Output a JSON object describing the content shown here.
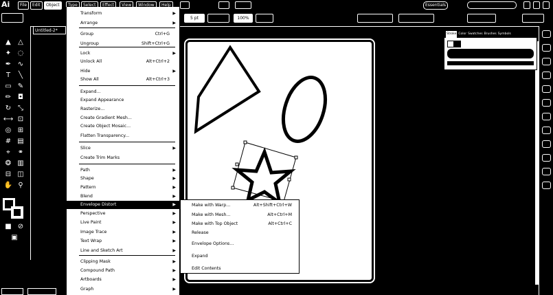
{
  "app": {
    "logo": "Ai"
  },
  "menubar": {
    "items": [
      "File",
      "Edit",
      "Object",
      "Type",
      "Select",
      "Effect",
      "View",
      "Window",
      "Help"
    ],
    "active": "Object",
    "workspace": "Essentials"
  },
  "controlbar": {
    "stroke_value": "5 pt",
    "opacity": "100%"
  },
  "document": {
    "tab_title": "Untitled-2*"
  },
  "object_menu": {
    "items": [
      {
        "label": "Transform",
        "shortcut": "",
        "submenu": true
      },
      {
        "label": "Arrange",
        "shortcut": "",
        "submenu": true
      },
      {
        "label": "Group",
        "shortcut": "Ctrl+G",
        "submenu": false
      },
      {
        "label": "Ungroup",
        "shortcut": "Shift+Ctrl+G",
        "submenu": false
      },
      {
        "label": "Lock",
        "shortcut": "",
        "submenu": true
      },
      {
        "label": "Unlock All",
        "shortcut": "Alt+Ctrl+2",
        "submenu": false
      },
      {
        "label": "Hide",
        "shortcut": "",
        "submenu": true
      },
      {
        "label": "Show All",
        "shortcut": "Alt+Ctrl+3",
        "submenu": false
      },
      {
        "label": "Expand...",
        "shortcut": "",
        "submenu": false
      },
      {
        "label": "Expand Appearance",
        "shortcut": "",
        "submenu": false
      },
      {
        "label": "Rasterize...",
        "shortcut": "",
        "submenu": false
      },
      {
        "label": "Create Gradient Mesh...",
        "shortcut": "",
        "submenu": false
      },
      {
        "label": "Create Object Mosaic...",
        "shortcut": "",
        "submenu": false
      },
      {
        "label": "Flatten Transparency...",
        "shortcut": "",
        "submenu": false
      },
      {
        "label": "Slice",
        "shortcut": "",
        "submenu": true
      },
      {
        "label": "Create Trim Marks",
        "shortcut": "",
        "submenu": false
      },
      {
        "label": "Path",
        "shortcut": "",
        "submenu": true
      },
      {
        "label": "Shape",
        "shortcut": "",
        "submenu": true
      },
      {
        "label": "Pattern",
        "shortcut": "",
        "submenu": true
      },
      {
        "label": "Blend",
        "shortcut": "",
        "submenu": true
      },
      {
        "label": "Envelope Distort",
        "shortcut": "",
        "submenu": true
      },
      {
        "label": "Perspective",
        "shortcut": "",
        "submenu": true
      },
      {
        "label": "Live Paint",
        "shortcut": "",
        "submenu": true
      },
      {
        "label": "Image Trace",
        "shortcut": "",
        "submenu": true
      },
      {
        "label": "Text Wrap",
        "shortcut": "",
        "submenu": true
      },
      {
        "label": "Line and Sketch Art",
        "shortcut": "",
        "submenu": true
      },
      {
        "label": "Clipping Mask",
        "shortcut": "",
        "submenu": true
      },
      {
        "label": "Compound Path",
        "shortcut": "",
        "submenu": true
      },
      {
        "label": "Artboards",
        "shortcut": "",
        "submenu": true
      },
      {
        "label": "Graph",
        "shortcut": "",
        "submenu": true
      }
    ],
    "highlighted": "Envelope Distort"
  },
  "envelope_submenu": {
    "items": [
      {
        "label": "Make with Warp...",
        "shortcut": "Alt+Shift+Ctrl+W"
      },
      {
        "label": "Make with Mesh...",
        "shortcut": "Alt+Ctrl+M"
      },
      {
        "label": "Make with Top Object",
        "shortcut": "Alt+Ctrl+C"
      },
      {
        "label": "Release",
        "shortcut": ""
      },
      {
        "label": "Envelope Options...",
        "shortcut": ""
      },
      {
        "label": "Expand",
        "shortcut": ""
      },
      {
        "label": "Edit Contents",
        "shortcut": ""
      }
    ]
  },
  "panel": {
    "tabs": [
      "Stroke",
      "Color",
      "Swatches",
      "Brushes",
      "Symbols"
    ]
  }
}
